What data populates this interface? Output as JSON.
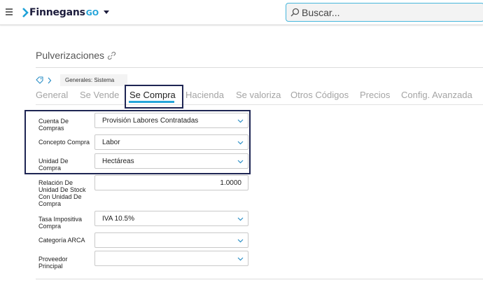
{
  "header": {
    "brand_name": "Finnegans",
    "brand_suffix": "GO",
    "search_placeholder": "Buscar..."
  },
  "page": {
    "title": "Pulverizaciones"
  },
  "breadcrumb": {
    "chip_label": "Generales: Sistema"
  },
  "tabs": [
    {
      "label": "General",
      "active": false
    },
    {
      "label": "Se Vende",
      "active": false
    },
    {
      "label": "Se Compra",
      "active": true
    },
    {
      "label": "Hacienda",
      "active": false
    },
    {
      "label": "Se valoriza",
      "active": false
    },
    {
      "label": "Otros Códigos",
      "active": false
    },
    {
      "label": "Precios",
      "active": false
    },
    {
      "label": "Config. Avanzada",
      "active": false
    }
  ],
  "form": {
    "cuenta_compras": {
      "label": "Cuenta De Compras",
      "value": "Provisión Labores Contratadas"
    },
    "concepto_compra": {
      "label": "Concepto Compra",
      "value": "Labor"
    },
    "unidad_compra": {
      "label": "Unidad De Compra",
      "value": "Hectáreas"
    },
    "relacion_unidad": {
      "label": "Relación De Unidad De Stock Con Unidad De Compra",
      "value": "1.0000"
    },
    "tasa_impositiva": {
      "label": "Tasa Impositiva Compra",
      "value": "IVA 10.5%"
    },
    "categoria_arca": {
      "label": "Categoría ARCA",
      "value": ""
    },
    "proveedor_principal": {
      "label": "Proveedor Principal",
      "value": ""
    }
  },
  "colors": {
    "brand_accent": "#1fa2d8",
    "active_tab_underline": "#27a6d9",
    "highlight_border": "#1e2553",
    "select_chevron": "#2b8fc7"
  }
}
